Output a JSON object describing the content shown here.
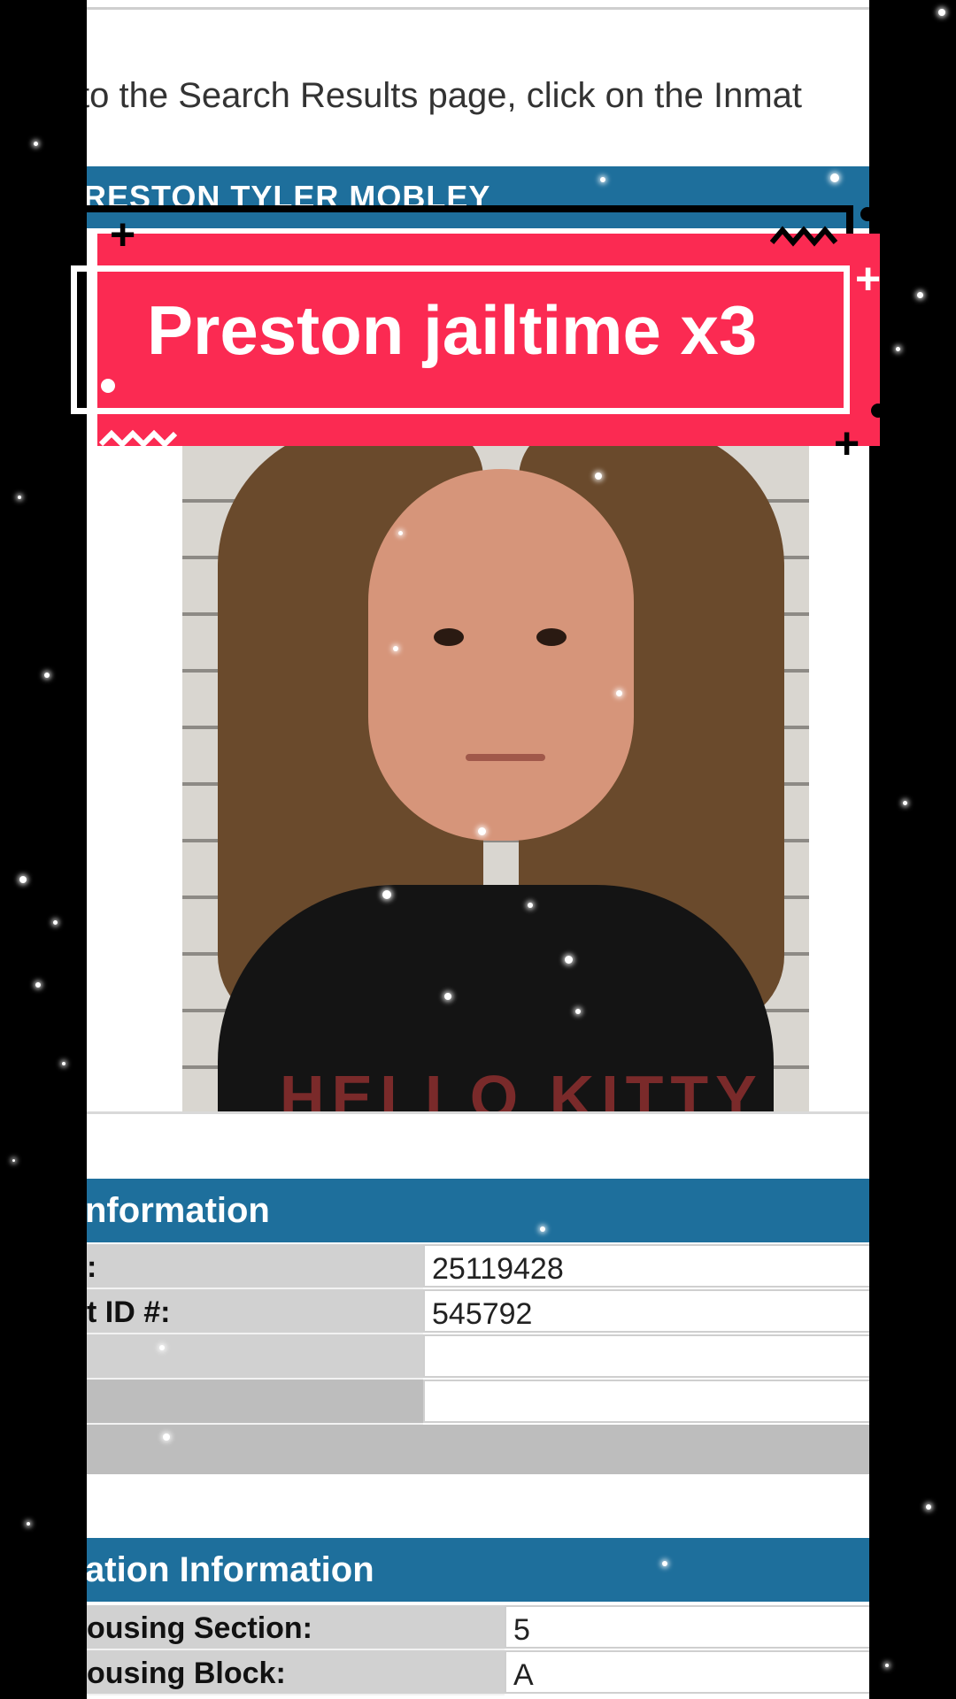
{
  "page": {
    "instruction_text": "to the Search Results page, click on the Inmat",
    "inmate_name": "RESTON TYLER MOBLEY"
  },
  "overlay": {
    "title": "Preston jailtime x3",
    "accent_color": "#fb2a52"
  },
  "mugshot": {
    "shirt_text": "HELLO KITTY"
  },
  "booking_section": {
    "header": "nformation",
    "rows": [
      {
        "label": ":",
        "value": "25119428"
      },
      {
        "label": "t ID #:",
        "value": "545792"
      },
      {
        "label": "",
        "value": ""
      },
      {
        "label": "",
        "value": ""
      }
    ]
  },
  "location_section": {
    "header": "ation Information",
    "rows": [
      {
        "label": "ousing Section:",
        "value": "5"
      },
      {
        "label": "ousing Block:",
        "value": "A"
      }
    ]
  },
  "colors": {
    "header_blue": "#1e6f9c",
    "label_gray": "#d1d1d1"
  }
}
